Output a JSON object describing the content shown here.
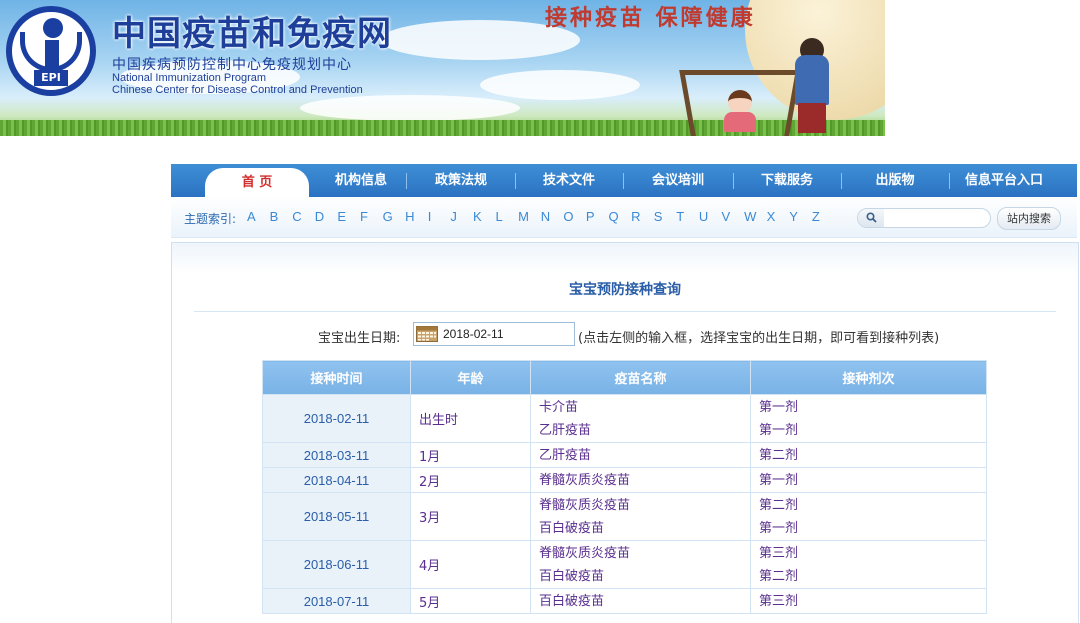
{
  "header": {
    "site_title": "中国疫苗和免疫网",
    "logo_text": "EPI",
    "org_cn": "中国疾病预防控制中心免疫规划中心",
    "org_en_line1": "National Immunization Program",
    "org_en_line2": "Chinese Center for Disease Control and Prevention",
    "slogan": "接种疫苗 保障健康"
  },
  "nav": {
    "items": [
      {
        "label": "首 页",
        "active": true
      },
      {
        "label": "机构信息"
      },
      {
        "label": "政策法规"
      },
      {
        "label": "技术文件"
      },
      {
        "label": "会议培训"
      },
      {
        "label": "下载服务"
      },
      {
        "label": "出版物"
      },
      {
        "label": "信息平台入口"
      }
    ]
  },
  "index_bar": {
    "label": "主题索引:",
    "letters": [
      "A",
      "B",
      "C",
      "D",
      "E",
      "F",
      "G",
      "H",
      "I",
      "J",
      "K",
      "L",
      "M",
      "N",
      "O",
      "P",
      "Q",
      "R",
      "S",
      "T",
      "U",
      "V",
      "W",
      "X",
      "Y",
      "Z"
    ],
    "search_placeholder": "",
    "search_button": "站内搜索"
  },
  "query": {
    "title": "宝宝预防接种查询",
    "birth_label": "宝宝出生日期:",
    "birth_value": "2018-02-11",
    "hint": "(点击左侧的输入框，选择宝宝的出生日期，即可看到接种列表)"
  },
  "table": {
    "headers": [
      "接种时间",
      "年龄",
      "疫苗名称",
      "接种剂次"
    ],
    "rows": [
      {
        "time": "2018-02-11",
        "age": "出生时",
        "vaccines": [
          "卡介苗",
          "乙肝疫苗"
        ],
        "doses": [
          "第一剂",
          "第一剂"
        ]
      },
      {
        "time": "2018-03-11",
        "age": "1月",
        "vaccines": [
          "乙肝疫苗"
        ],
        "doses": [
          "第二剂"
        ]
      },
      {
        "time": "2018-04-11",
        "age": "2月",
        "vaccines": [
          "脊髓灰质炎疫苗"
        ],
        "doses": [
          "第一剂"
        ]
      },
      {
        "time": "2018-05-11",
        "age": "3月",
        "vaccines": [
          "脊髓灰质炎疫苗",
          "百白破疫苗"
        ],
        "doses": [
          "第二剂",
          "第一剂"
        ]
      },
      {
        "time": "2018-06-11",
        "age": "4月",
        "vaccines": [
          "脊髓灰质炎疫苗",
          "百白破疫苗"
        ],
        "doses": [
          "第三剂",
          "第二剂"
        ]
      },
      {
        "time": "2018-07-11",
        "age": "5月",
        "vaccines": [
          "百白破疫苗"
        ],
        "doses": [
          "第三剂"
        ]
      }
    ]
  },
  "colors": {
    "nav_blue": "#2b72c2",
    "home_red": "#d22d2d",
    "header_blue": "#79b2e6",
    "cell_purple": "#5a2f8f"
  }
}
